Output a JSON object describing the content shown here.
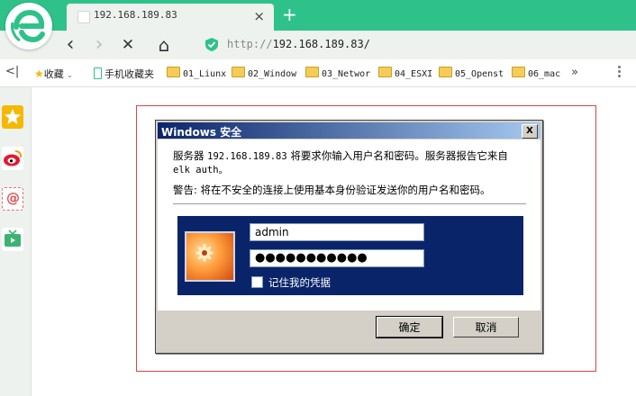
{
  "browser": {
    "tab": {
      "title": "192.168.189.83",
      "close_glyph": "×"
    },
    "new_tab_glyph": "+",
    "nav": {
      "back_glyph": "‹",
      "forward_glyph": "›",
      "stop_glyph": "✕",
      "home_glyph": "⌂"
    },
    "address": {
      "scheme": "http://",
      "host": "192.168.189.83/"
    }
  },
  "bookmarks": {
    "collapse_glyph": "<|",
    "items": [
      {
        "label": "收藏",
        "icon": "star-icon"
      },
      {
        "label": "手机收藏夹",
        "icon": "phone-icon"
      },
      {
        "label": "01_Liunx",
        "icon": "folder-icon"
      },
      {
        "label": "02_Window",
        "icon": "folder-icon"
      },
      {
        "label": "03_Networ",
        "icon": "folder-icon"
      },
      {
        "label": "04_ESXI",
        "icon": "folder-icon"
      },
      {
        "label": "05_Openst",
        "icon": "folder-icon"
      },
      {
        "label": "06_mac",
        "icon": "folder-icon"
      }
    ],
    "more_glyph": "»"
  },
  "sidebar": {
    "buttons": [
      {
        "icon": "star-icon",
        "color": "#f5b800"
      },
      {
        "icon": "weibo-icon",
        "color": "#e6162d"
      },
      {
        "icon": "mail-icon",
        "color": "#e05050"
      },
      {
        "icon": "tv-icon",
        "color": "#3cb371"
      }
    ]
  },
  "dialog": {
    "title": "Windows 安全",
    "close_glyph": "X",
    "message_prefix": "服务器",
    "message_host": "192.168.189.83",
    "message_suffix": "将要求你输入用户名和密码。服务器报告它来自",
    "message_realm": "elk auth。",
    "warning": "警告: 将在不安全的连接上使用基本身份验证发送你的用户名和密码。",
    "username": "admin",
    "password_mask": "●●●●●●●●●●●",
    "remember_label": "记住我的凭据",
    "ok_label": "确定",
    "cancel_label": "取消"
  },
  "colors": {
    "tab_strip": "#2ec28a",
    "title_bar_start": "#0a246a",
    "credential_panel": "#0a246a",
    "frame_border": "#d94545"
  }
}
